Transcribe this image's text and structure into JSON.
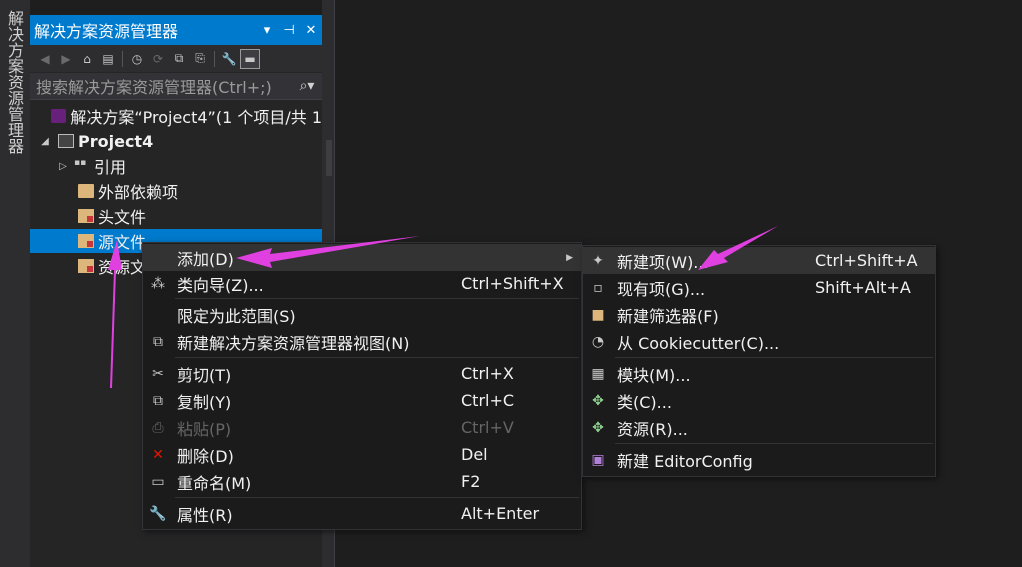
{
  "sidebar": {
    "vertical_tab": "解决方案资源管理器"
  },
  "panel": {
    "title": "解决方案资源管理器",
    "title_buttons": [
      "▾",
      "⊣",
      "✕"
    ],
    "search_placeholder": "搜索解决方案资源管理器(Ctrl+;)",
    "search_icon": "⌕▾"
  },
  "tree": [
    {
      "label": "解决方案“Project4”(1 个项目/共 1"
    },
    {
      "label": "Project4"
    },
    {
      "label": "引用"
    },
    {
      "label": "外部依赖项"
    },
    {
      "label": "头文件"
    },
    {
      "label": "源文件"
    },
    {
      "label": "资源文"
    }
  ],
  "context_menu": {
    "items": [
      {
        "label": "添加(D)",
        "shortcut": ""
      },
      {
        "label": "类向导(Z)...",
        "shortcut": "Ctrl+Shift+X"
      },
      {
        "label": "限定为此范围(S)",
        "shortcut": ""
      },
      {
        "label": "新建解决方案资源管理器视图(N)",
        "shortcut": ""
      },
      {
        "label": "剪切(T)",
        "shortcut": "Ctrl+X"
      },
      {
        "label": "复制(Y)",
        "shortcut": "Ctrl+C"
      },
      {
        "label": "粘贴(P)",
        "shortcut": "Ctrl+V"
      },
      {
        "label": "删除(D)",
        "shortcut": "Del"
      },
      {
        "label": "重命名(M)",
        "shortcut": "F2"
      },
      {
        "label": "属性(R)",
        "shortcut": "Alt+Enter"
      }
    ]
  },
  "submenu": {
    "items": [
      {
        "label": "新建项(W)...",
        "shortcut": "Ctrl+Shift+A"
      },
      {
        "label": "现有项(G)...",
        "shortcut": "Shift+Alt+A"
      },
      {
        "label": "新建筛选器(F)",
        "shortcut": ""
      },
      {
        "label": "从 Cookiecutter(C)...",
        "shortcut": ""
      },
      {
        "label": "模块(M)...",
        "shortcut": ""
      },
      {
        "label": "类(C)...",
        "shortcut": ""
      },
      {
        "label": "资源(R)...",
        "shortcut": ""
      },
      {
        "label": "新建 EditorConfig",
        "shortcut": ""
      }
    ]
  },
  "colors": {
    "accent": "#007acc",
    "annotation_arrow": "#e040e0",
    "delete_icon": "#e51400"
  }
}
